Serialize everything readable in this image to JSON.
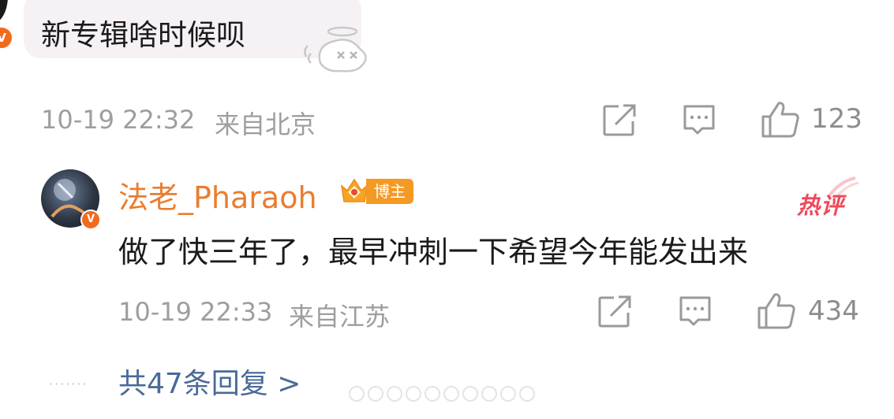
{
  "comment": {
    "text": "新专辑啥时候呗",
    "date": "10-19 22:32",
    "location": "来自北京",
    "likes": "123",
    "verified_badge": "V"
  },
  "reply": {
    "username": "法老_Pharaoh",
    "rank_badge_icon": "crown-rank-icon",
    "role_badge": "博主",
    "hot_tag": "热评",
    "text": "做了快三年了，最早冲刺一下希望今年能发出来",
    "date": "10-19 22:33",
    "location": "来自江苏",
    "likes": "434",
    "verified_badge": "V"
  },
  "more_replies": "共47条回复 >",
  "colors": {
    "username": "#ea7d2f",
    "link": "#4a6a99",
    "hot_tag": "#f2475a",
    "badge": "#f49a24",
    "verified": "#f26b1d",
    "meta": "#9e9e9e"
  }
}
